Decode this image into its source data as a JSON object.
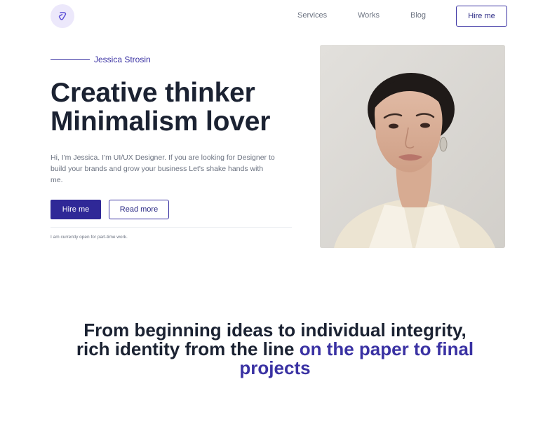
{
  "nav": {
    "logo_icon": "drop-leaf-icon",
    "links": [
      "Services",
      "Works",
      "Blog"
    ],
    "hire_label": "Hire me"
  },
  "hero": {
    "eyebrow": "Jessica Strosin",
    "title_line1": "Creative thinker",
    "title_line2": "Minimalism lover",
    "description": "Hi, I'm Jessica. I'm UI/UX Designer. If you are looking for Designer to build your brands and grow your business Let's shake hands with me.",
    "primary_button": "Hire me",
    "secondary_button": "Read more",
    "availability": "I am currently open for part-time work."
  },
  "portrait": {
    "alt": "Portrait of Jessica Strosin"
  },
  "tagline": {
    "part1": "From beginning ideas to individual integrity,",
    "part2": "rich identity from the line ",
    "accent": "on the paper to final projects"
  },
  "colors": {
    "primary": "#2f2897",
    "accent_text": "#3a32a3",
    "heading": "#1b2232",
    "muted": "#6b7280",
    "logo_bg": "#ece8fb"
  }
}
